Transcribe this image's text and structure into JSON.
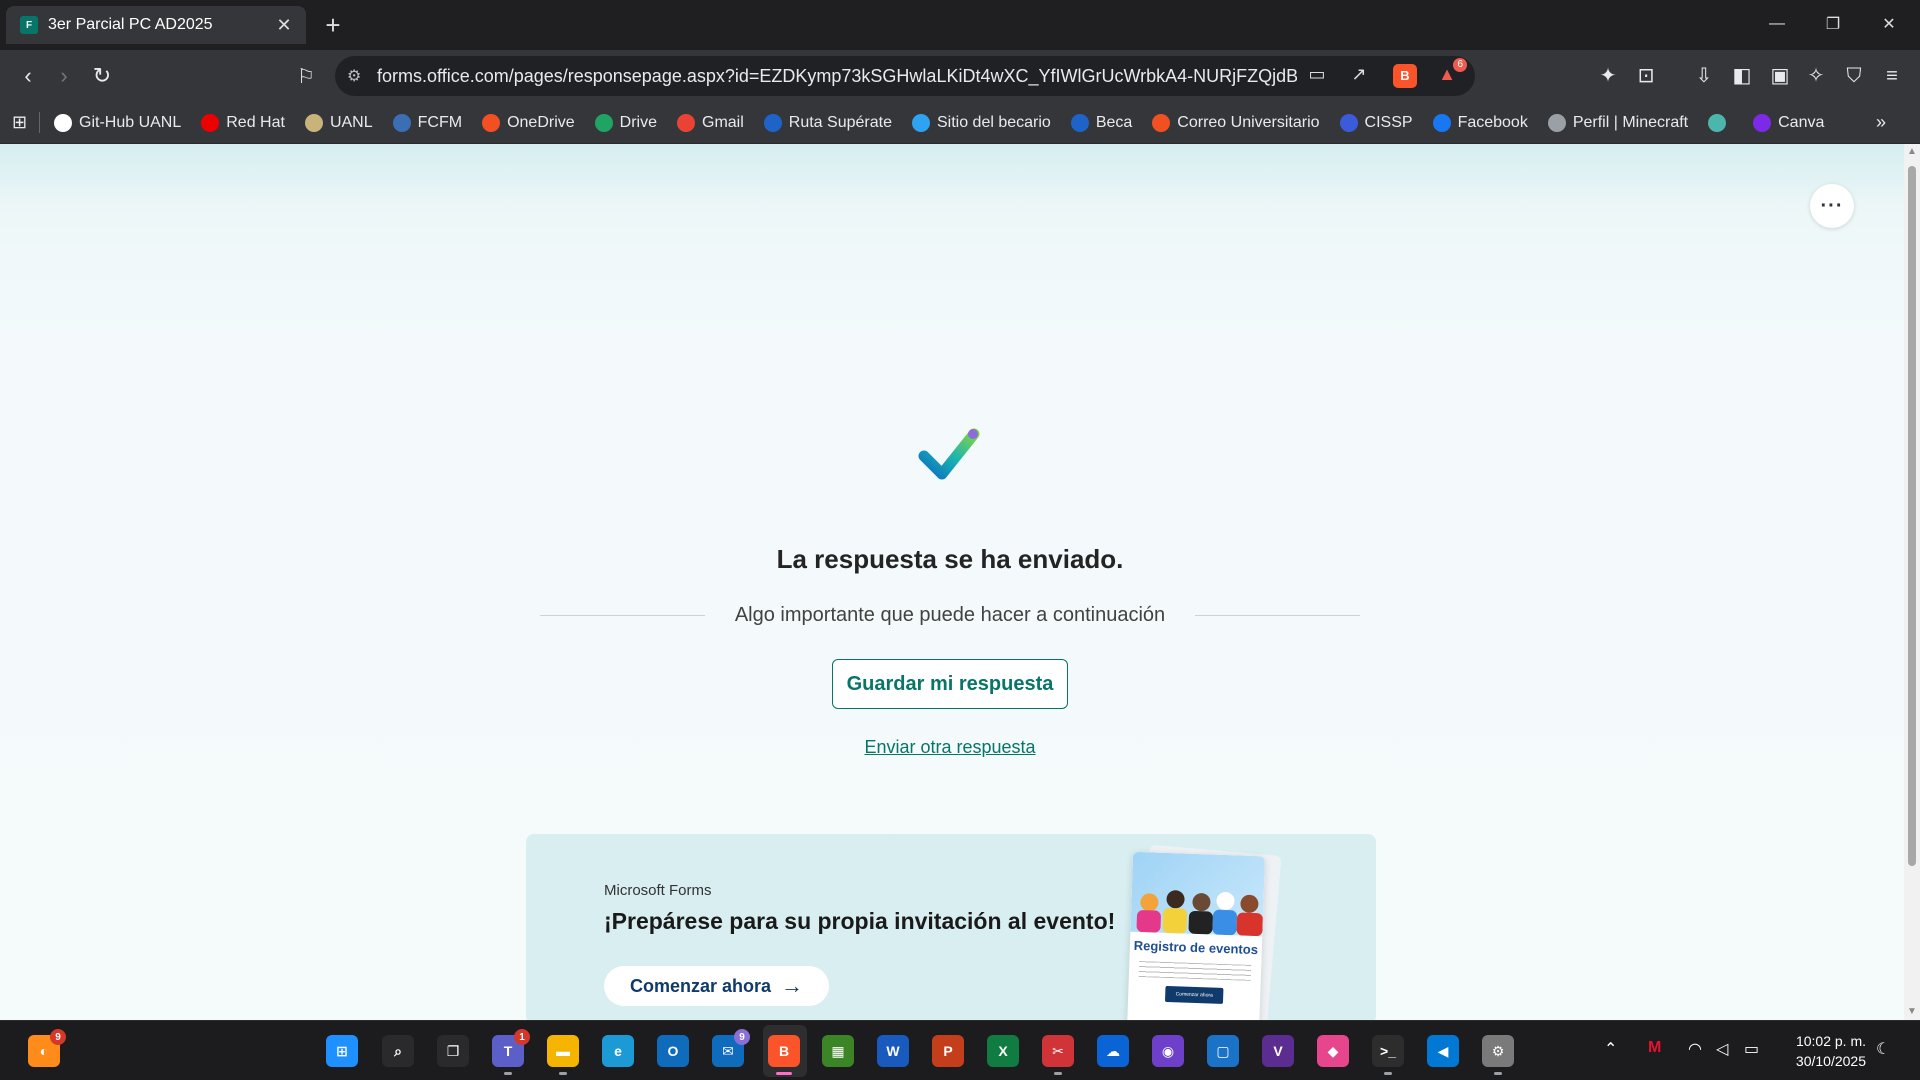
{
  "tab": {
    "title": "3er Parcial PC AD2025",
    "favicon": "F"
  },
  "address": {
    "url": "forms.office.com/pages/responsepage.aspx?id=EZDKymp73kSGHwlaLKiDt4wXC_YfIWlGrUcWrbkA4-NURjFZQjdBMkJ...",
    "brave_badge": "6"
  },
  "bookmarks": [
    {
      "label": "Git-Hub UANL",
      "color": "#ffffff",
      "icon": "github-icon"
    },
    {
      "label": "Red Hat",
      "color": "#ee0000",
      "icon": "redhat-icon"
    },
    {
      "label": "UANL",
      "color": "#c9b37b",
      "icon": "uanl-icon"
    },
    {
      "label": "FCFM",
      "color": "#3a6fb6",
      "icon": "fcfm-icon"
    },
    {
      "label": "OneDrive",
      "color": "#f25022",
      "icon": "microsoft-icon"
    },
    {
      "label": "Drive",
      "color": "#1fa463",
      "icon": "drive-icon"
    },
    {
      "label": "Gmail",
      "color": "#ea4335",
      "icon": "gmail-icon"
    },
    {
      "label": "Ruta Supérate",
      "color": "#1e64c8",
      "icon": "ruta-icon"
    },
    {
      "label": "Sitio del becario",
      "color": "#2ea3f2",
      "icon": "becario-icon"
    },
    {
      "label": "Beca",
      "color": "#1e64c8",
      "icon": "beca-icon"
    },
    {
      "label": "Correo Universitario",
      "color": "#f25022",
      "icon": "microsoft-icon"
    },
    {
      "label": "CISSP",
      "color": "#3b5bdb",
      "icon": "cissp-icon"
    },
    {
      "label": "Facebook",
      "color": "#1877f2",
      "icon": "facebook-icon"
    },
    {
      "label": "Perfil | Minecraft",
      "color": "#9aa0a6",
      "icon": "globe-icon"
    },
    {
      "label": "",
      "color": "#4db6ac",
      "icon": "classroom-icon"
    },
    {
      "label": "Canva",
      "color": "#7d2ae8",
      "icon": "canva-icon"
    }
  ],
  "page": {
    "headline": "La respuesta se ha enviado.",
    "next_text": "Algo importante que puede hacer a continuación",
    "save_button": "Guardar mi respuesta",
    "another_link": "Enviar otra respuesta",
    "more_button": "···"
  },
  "promo": {
    "brand": "Microsoft Forms",
    "title": "¡Prepárese para su propia invitación al evento!",
    "button": "Comenzar ahora",
    "card_title": "Registro de eventos",
    "card_cta": "Comenzar ahora"
  },
  "taskbar": {
    "apps": [
      {
        "name": "widgets-icon",
        "color": "#ff8c1a",
        "badge": "9"
      },
      {
        "name": "start-icon",
        "color": "#1e90ff",
        "badge": ""
      },
      {
        "name": "search-icon",
        "color": "#2a2a2c",
        "badge": ""
      },
      {
        "name": "task-view-icon",
        "color": "#2a2a2c",
        "badge": ""
      },
      {
        "name": "teams-icon",
        "color": "#5b5fc7",
        "badge": "1"
      },
      {
        "name": "file-explorer-icon",
        "color": "#f4b400",
        "badge": ""
      },
      {
        "name": "edge-icon",
        "color": "#1c9ad6",
        "badge": ""
      },
      {
        "name": "outlook-icon",
        "color": "#0f6cbd",
        "badge": ""
      },
      {
        "name": "mail-icon",
        "color": "#0f6cbd",
        "badge": "9"
      },
      {
        "name": "brave-icon",
        "color": "#fb542b",
        "badge": ""
      },
      {
        "name": "minecraft-icon",
        "color": "#3c8527",
        "badge": ""
      },
      {
        "name": "word-icon",
        "color": "#185abd",
        "badge": ""
      },
      {
        "name": "powerpoint-icon",
        "color": "#c43e1c",
        "badge": ""
      },
      {
        "name": "excel-icon",
        "color": "#107c41",
        "badge": ""
      },
      {
        "name": "snipping-tool-icon",
        "color": "#d13438",
        "badge": ""
      },
      {
        "name": "onedrive-icon",
        "color": "#0a64d6",
        "badge": ""
      },
      {
        "name": "github-desktop-icon",
        "color": "#6e40c9",
        "badge": ""
      },
      {
        "name": "virtualbox-icon",
        "color": "#1a73c7",
        "badge": ""
      },
      {
        "name": "visual-studio-icon",
        "color": "#5c2d91",
        "badge": ""
      },
      {
        "name": "copilot-icon",
        "color": "#e8468c",
        "badge": ""
      },
      {
        "name": "terminal-icon",
        "color": "#2d2d2d",
        "badge": ""
      },
      {
        "name": "vscode-icon",
        "color": "#0078d4",
        "badge": ""
      },
      {
        "name": "settings-icon",
        "color": "#7a7a7a",
        "badge": ""
      }
    ],
    "time": "10:02 p. m.",
    "date": "30/10/2025"
  }
}
